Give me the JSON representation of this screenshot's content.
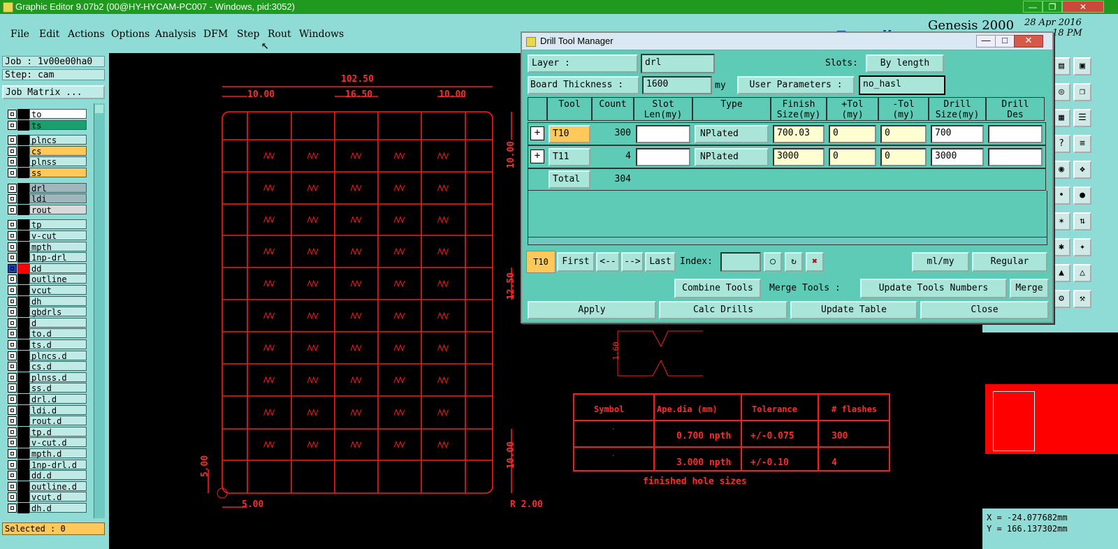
{
  "window": {
    "title": "Graphic Editor 9.07b2 (00@HY-HYCAM-PC007 - Windows, pid:3052)",
    "minimize": "—",
    "restore": "❐",
    "close": "✕"
  },
  "menu": [
    "File",
    "Edit",
    "Actions",
    "Options",
    "Analysis",
    "DFM",
    "Step",
    "Rout",
    "Windows"
  ],
  "brand": {
    "name": "Frontline",
    "product": "Genesis 2000",
    "date": "28 Apr 2016",
    "time": "18 PM"
  },
  "left_panel": {
    "job": "Job : 1v00e00ha0",
    "step": "Step: cam",
    "job_matrix": "Job Matrix ...",
    "layers": [
      {
        "name": "to",
        "color": "#ffffff"
      },
      {
        "name": "ts",
        "color": "#1aa06e"
      },
      {
        "name": "plncs",
        "color": "#bfeae5"
      },
      {
        "name": "cs",
        "color": "#ffc85a"
      },
      {
        "name": "plnss",
        "color": "#bfeae5"
      },
      {
        "name": "ss",
        "color": "#ffc85a"
      },
      {
        "name": "drl",
        "color": "#9fb6bd"
      },
      {
        "name": "ldi",
        "color": "#9fb6bd"
      },
      {
        "name": "rout",
        "color": "#d9d9d9"
      },
      {
        "name": "tp",
        "color": "#bfeae5"
      },
      {
        "name": "v-cut",
        "color": "#bfeae5"
      },
      {
        "name": "mpth",
        "color": "#bfeae5"
      },
      {
        "name": "1np-drl",
        "color": "#bfeae5"
      },
      {
        "name": "dd",
        "color": "#bfeae5"
      },
      {
        "name": "outline",
        "color": "#bfeae5"
      },
      {
        "name": "vcut",
        "color": "#bfeae5"
      },
      {
        "name": "dh",
        "color": "#bfeae5"
      },
      {
        "name": "gbdrls",
        "color": "#bfeae5"
      },
      {
        "name": "d",
        "color": "#bfeae5"
      },
      {
        "name": "to.d",
        "color": "#bfeae5"
      },
      {
        "name": "ts.d",
        "color": "#bfeae5"
      },
      {
        "name": "plncs.d",
        "color": "#bfeae5"
      },
      {
        "name": "cs.d",
        "color": "#bfeae5"
      },
      {
        "name": "plnss.d",
        "color": "#bfeae5"
      },
      {
        "name": "ss.d",
        "color": "#bfeae5"
      },
      {
        "name": "drl.d",
        "color": "#bfeae5"
      },
      {
        "name": "ldi.d",
        "color": "#bfeae5"
      },
      {
        "name": "rout.d",
        "color": "#bfeae5"
      },
      {
        "name": "tp.d",
        "color": "#bfeae5"
      },
      {
        "name": "v-cut.d",
        "color": "#bfeae5"
      },
      {
        "name": "mpth.d",
        "color": "#bfeae5"
      },
      {
        "name": "1np-drl.d",
        "color": "#bfeae5"
      },
      {
        "name": "dd.d",
        "color": "#bfeae5"
      },
      {
        "name": "outline.d",
        "color": "#bfeae5"
      },
      {
        "name": "vcut.d",
        "color": "#bfeae5"
      },
      {
        "name": "dh.d",
        "color": "#bfeae5"
      }
    ],
    "selected": "Selected : 0"
  },
  "drawing": {
    "dim_total": "102.50",
    "dim_a": "10.00",
    "dim_b": "16.50",
    "dim_c": "10.00",
    "dim_r1": "10.00",
    "dim_r2": "12.50",
    "dim_r3": "10.00",
    "dim_l": "5.00",
    "dim_b2": "5.00",
    "dim_radius": "R 2.00",
    "dim_160": "1.60",
    "table": {
      "headers": [
        "Symbol",
        "Ape.dia (mm)",
        "Tolerance",
        "# flashes"
      ],
      "rows": [
        [
          "′",
          "0.700 npth",
          "+/-0.075",
          "300"
        ],
        [
          "′",
          "3.000 npth",
          "+/-0.10",
          "4"
        ]
      ],
      "caption": "finished hole sizes"
    }
  },
  "dialog": {
    "title": "Drill Tool Manager",
    "layer_label": "Layer        :",
    "layer_value": "drl",
    "slots_label": "Slots:",
    "slots_value": "By length",
    "board_thickness_label": "Board Thickness :",
    "board_thickness_value": "1600",
    "board_thickness_unit": "my",
    "user_params_label": "User Parameters :",
    "user_params_value": "no_hasl",
    "columns": [
      "Tool",
      "Count",
      "Slot\nLen(my)",
      "Type",
      "Finish\nSize(my)",
      "+Tol\n(my)",
      "-Tol\n(my)",
      "Drill\nSize(my)",
      "Drill\nDes"
    ],
    "rows": [
      {
        "tool": "T10",
        "count": "300",
        "slot": "",
        "type": "NPlated",
        "finish": "700.03",
        "ptol": "0",
        "ntol": "0",
        "drill": "700",
        "des": ""
      },
      {
        "tool": "T11",
        "count": "4",
        "slot": "",
        "type": "NPlated",
        "finish": "3000",
        "ptol": "0",
        "ntol": "0",
        "drill": "3000",
        "des": ""
      }
    ],
    "total_label": "Total",
    "total_count": "304",
    "current_tool": "T10",
    "nav": {
      "first": "First",
      "prev": "<--",
      "next": "-->",
      "last": "Last",
      "index": "Index:"
    },
    "units": "ml/my",
    "mode": "Regular",
    "combine": "Combine Tools",
    "merge_label": "Merge Tools :",
    "update_numbers": "Update Tools Numbers",
    "merge": "Merge",
    "apply": "Apply",
    "calc": "Calc Drills",
    "update_table": "Update Table",
    "close": "Close"
  },
  "coords": {
    "x": "X = -24.077682mm",
    "y": "Y = 166.137302mm"
  }
}
